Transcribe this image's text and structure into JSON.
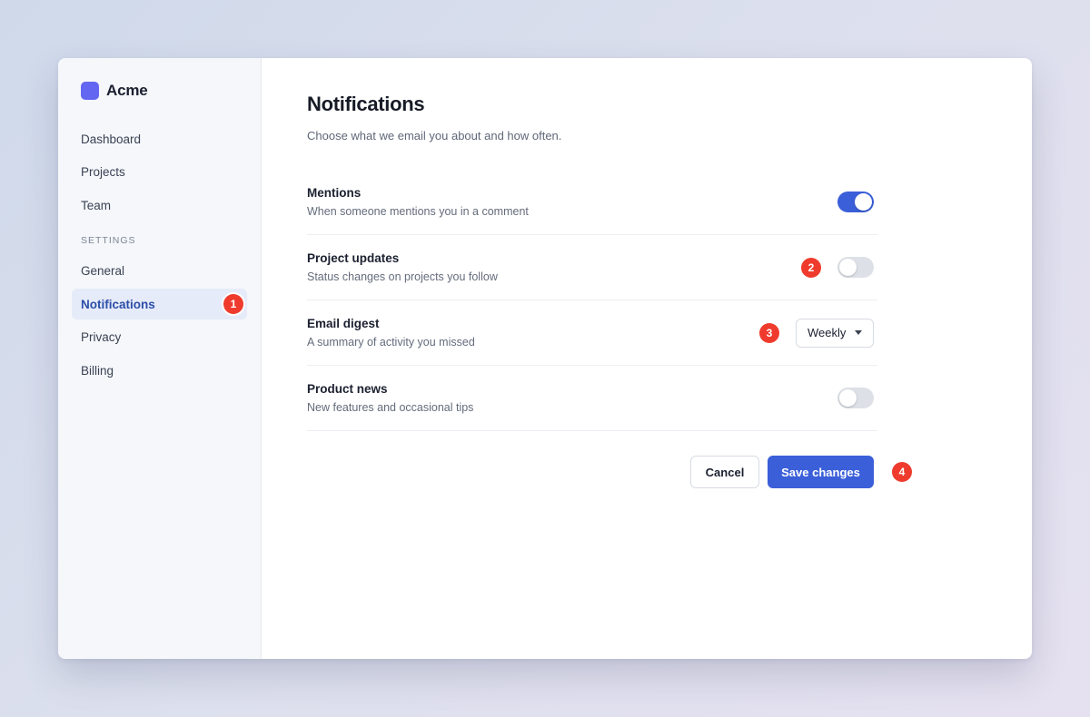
{
  "app": {
    "name": "Acme"
  },
  "sidebar": {
    "items": [
      {
        "label": "Dashboard"
      },
      {
        "label": "Projects"
      },
      {
        "label": "Team"
      }
    ],
    "section_label": "SETTINGS",
    "settings_items": [
      {
        "label": "General"
      },
      {
        "label": "Notifications",
        "active": true,
        "badge": "1"
      },
      {
        "label": "Privacy"
      },
      {
        "label": "Billing"
      }
    ]
  },
  "main": {
    "title": "Notifications",
    "subtitle": "Choose what we email you about and how often.",
    "settings": [
      {
        "title": "Mentions",
        "description": "When someone mentions you in a comment",
        "control": "toggle",
        "on": true
      },
      {
        "title": "Project updates",
        "description": "Status changes on projects you follow",
        "control": "toggle",
        "on": false,
        "badge": "2"
      },
      {
        "title": "Email digest",
        "description": "A summary of activity you missed",
        "control": "select",
        "value": "Weekly",
        "badge": "3"
      },
      {
        "title": "Product news",
        "description": "New features and occasional tips",
        "control": "toggle",
        "on": false
      }
    ],
    "actions": {
      "cancel_label": "Cancel",
      "save_label": "Save changes",
      "badge": "4"
    }
  },
  "colors": {
    "accent": "#3b5fd9",
    "brand": "#6366f1",
    "badge": "#ef3b2d"
  }
}
